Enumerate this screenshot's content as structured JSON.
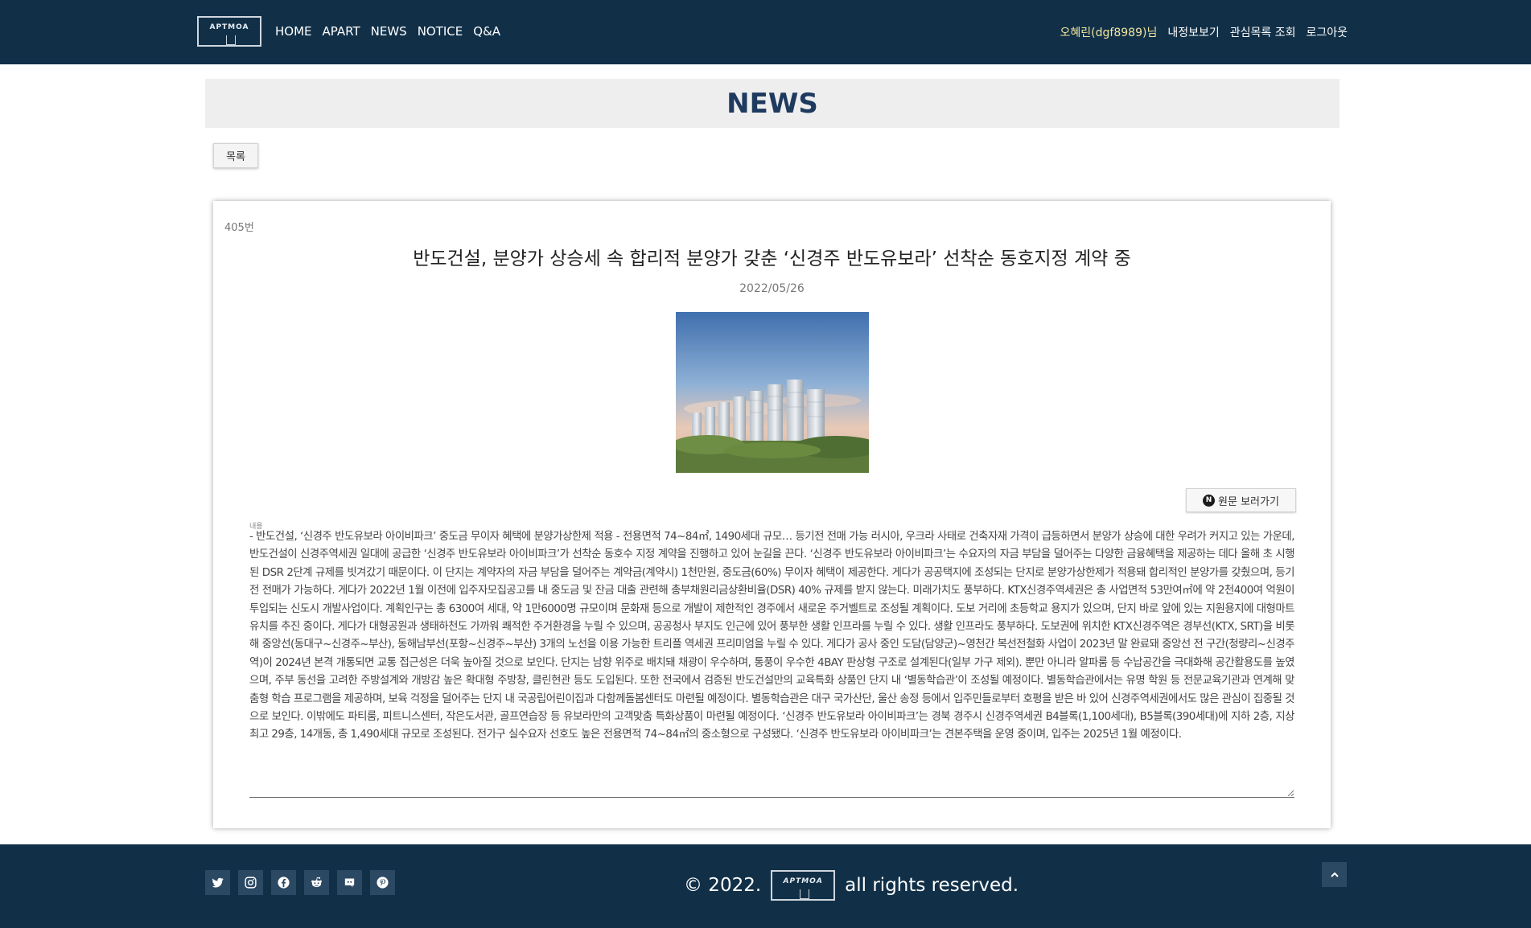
{
  "header": {
    "logo_text": "APTMOA",
    "nav": [
      "HOME",
      "APART",
      "NEWS",
      "NOTICE",
      "Q&A"
    ],
    "user_name": "오혜린(dgf8989)님",
    "links": [
      "내정보보기",
      "관심목록 조회",
      "로그아웃"
    ]
  },
  "page": {
    "heading": "NEWS",
    "list_button": "목록"
  },
  "article": {
    "number": "405번",
    "title": "반도건설, 분양가 상승세 속 합리적 분양가 갖춘 ‘신경주 반도유보라’ 선착순 동호지정 계약 중",
    "date": "2022/05/26",
    "original_button": "원문 보러가기",
    "original_icon": "N",
    "content_label": "내용",
    "content": "- 반도건설, ‘신경주 반도유보라 아이비파크’ 중도금 무이자 혜택에 분양가상한제 적용 - 전용면적 74~84㎡, 1490세대 규모… 등기전 전매 가능 러시아, 우크라 사태로 건축자재 가격이 급등하면서 분양가 상승에 대한 우려가 커지고 있는 가운데, 반도건설이 신경주역세권 일대에 공급한 ‘신경주 반도유보라 아이비파크’가 선착순 동호수 지정 계약을 진행하고 있어 눈길을 끈다. ‘신경주 반도유보라 아이비파크’는 수요자의 자금 부담을 덜어주는 다양한 금융혜택을 제공하는 데다 올해 초 시행된 DSR 2단계 규제를 빗겨갔기 때문이다. 이 단지는 계약자의 자금 부담을 덜어주는 계약금(계약시) 1천만원, 중도금(60%) 무이자 혜택이 제공한다. 게다가 공공택지에 조성되는 단지로 분양가상한제가 적용돼 합리적인 분양가를 갖췄으며, 등기전 전매가 가능하다. 게다가 2022년 1월 이전에 입주자모집공고를 내 중도금 및 잔금 대출 관련해 총부채원리금상환비율(DSR) 40% 규제를 받지 않는다. 미래가치도 풍부하다. KTX신경주역세권은 총 사업면적 53만여㎡에 약 2천400여 억원이 투입되는 신도시 개발사업이다. 계획인구는 총 6300여 세대, 약 1만6000명 규모이며 문화재 등으로 개발이 제한적인 경주에서 새로운 주거벨트로 조성될 계획이다. 도보 거리에 초등학교 용지가 있으며, 단지 바로 앞에 있는 지원용지에 대형마트 유치를 추진 중이다. 게다가 대형공원과 생태하천도 가까워 쾌적한 주거환경을 누릴 수 있으며, 공공청사 부지도 인근에 있어 풍부한 생활 인프라를 누릴 수 있다. 생활 인프라도 풍부하다. 도보권에 위치한 KTX신경주역은 경부선(KTX, SRT)을 비롯해 중앙선(동대구~신경주~부산), 동해남부선(포항~신경주~부산) 3개의 노선을 이용 가능한 트리플 역세권 프리미엄을 누릴 수 있다. 게다가 공사 중인 도담(담양군)~영천간 복선전철화 사업이 2023년 말 완료돼 중앙선 전 구간(청량리~신경주역)이 2024년 본격 개통되면 교통 접근성은 더욱 높아질 것으로 보인다. 단지는 남향 위주로 배치돼 채광이 우수하며, 통풍이 우수한 4BAY 판상형 구조로 설계된다(일부 가구 제외). 뿐만 아니라 알파룸 등 수납공간을 극대화해 공간활용도를 높였으며, 주부 동선을 고려한 주방설계와 개방감 높은 확대형 주방창, 클린현관 등도 도입된다. 또한 전국에서 검증된 반도건설만의 교육특화 상품인 단지 내 ‘별동학습관’이 조성될 예정이다. 별동학습관에서는 유명 학원 등 전문교육기관과 연계해 맞춤형 학습 프로그램을 제공하며, 보육 걱정을 덜어주는 단지 내 국공립어린이집과 다함께돌봄센터도 마련될 예정이다. 별동학습관은 대구 국가산단, 울산 송정 등에서 입주민들로부터 호평을 받은 바 있어 신경주역세권에서도 많은 관심이 집중될 것으로 보인다. 이밖에도 파티룸, 피트니스센터, 작은도서관, 골프연습장 등 유보라만의 고객맞춤 특화상품이 마련될 예정이다. ‘신경주 반도유보라 아이비파크’는 경북 경주시 신경주역세권 B4블록(1,100세대), B5블록(390세대)에 지하 2층, 지상 최고 29층, 14개동, 총 1,490세대 규모로 조성된다. 전가구 실수요자 선호도 높은 전용면적 74~84㎡의 중소형으로 구성됐다. ‘신경주 반도유보라 아이비파크’는 견본주택을 운영 중이며, 입주는 2025년 1월 예정이다."
  },
  "footer": {
    "copyright_prefix": "© 2022.",
    "logo_text": "APTMOA",
    "copyright_suffix": "all rights reserved.",
    "social_icons": [
      "twitter-icon",
      "instagram-icon",
      "facebook-icon",
      "reddit-icon",
      "discord-icon",
      "pinterest-icon"
    ]
  },
  "colors": {
    "header_bg": "#113048",
    "footer_bg": "#113048",
    "heading": "#1e3a5f",
    "username": "#f2e6a0"
  }
}
